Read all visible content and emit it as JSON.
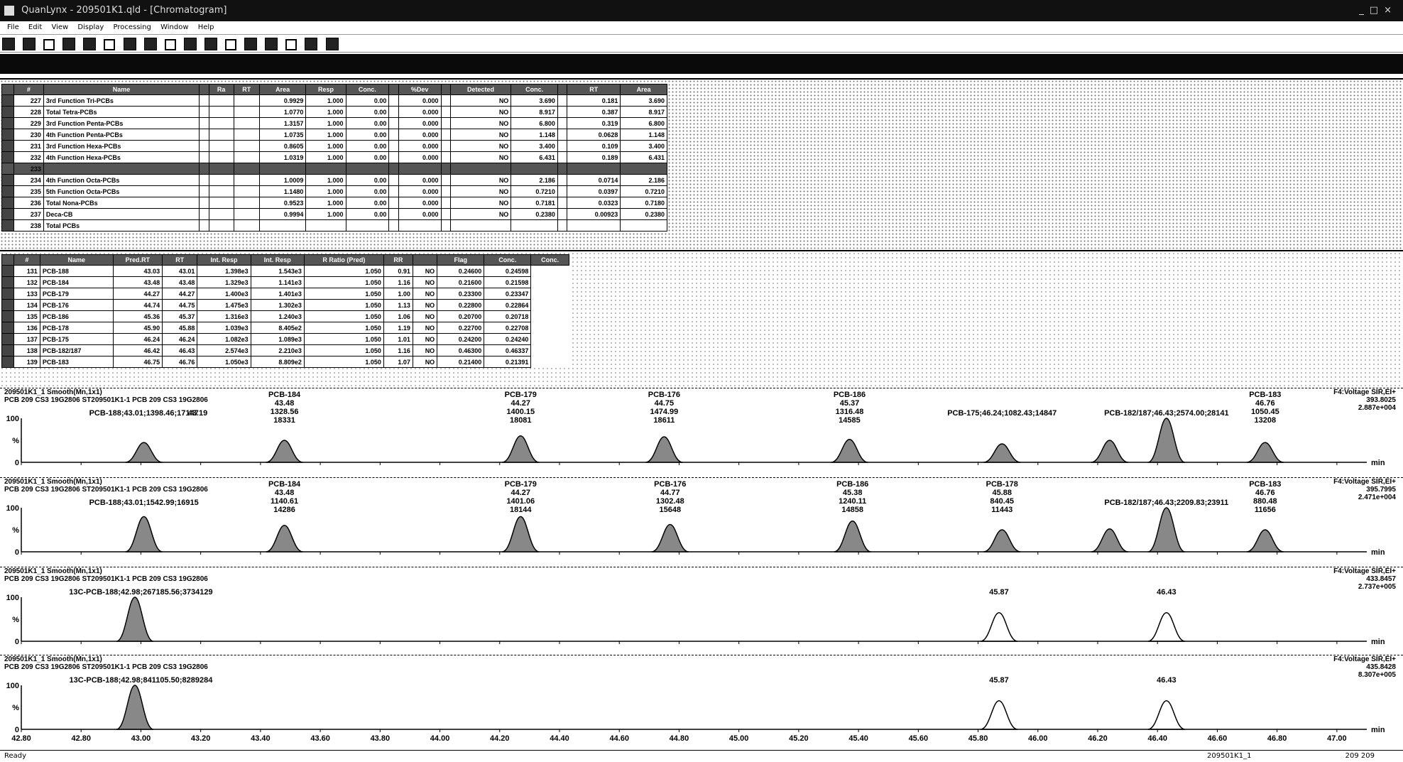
{
  "window": {
    "title": "QuanLynx - 209501K1.qld - [Chromatogram]"
  },
  "menu": [
    "File",
    "Edit",
    "View",
    "Display",
    "Processing",
    "Window",
    "Help"
  ],
  "table1": {
    "columns": [
      "#",
      "Name",
      "",
      "Ra",
      "RT",
      "Area",
      "Resp",
      "Conc.",
      "",
      "%Dev",
      "",
      "Detected",
      "Conc.",
      "",
      "RT",
      "Area"
    ],
    "rows": [
      [
        "227",
        "3rd Function Tri-PCBs",
        "",
        "",
        "",
        "0.9929",
        "1.000",
        "0.00",
        "",
        "0.000",
        "",
        "NO",
        "3.690",
        "",
        "0.181",
        "3.690"
      ],
      [
        "228",
        "Total Tetra-PCBs",
        "",
        "",
        "",
        "1.0770",
        "1.000",
        "0.00",
        "",
        "0.000",
        "",
        "NO",
        "8.917",
        "",
        "0.387",
        "8.917"
      ],
      [
        "229",
        "3rd Function Penta-PCBs",
        "",
        "",
        "",
        "1.3157",
        "1.000",
        "0.00",
        "",
        "0.000",
        "",
        "NO",
        "6.800",
        "",
        "0.319",
        "6.800"
      ],
      [
        "230",
        "4th Function Penta-PCBs",
        "",
        "",
        "",
        "1.0735",
        "1.000",
        "0.00",
        "",
        "0.000",
        "",
        "NO",
        "1.148",
        "",
        "0.0628",
        "1.148"
      ],
      [
        "231",
        "3rd Function Hexa-PCBs",
        "",
        "",
        "",
        "0.8605",
        "1.000",
        "0.00",
        "",
        "0.000",
        "",
        "NO",
        "3.400",
        "",
        "0.109",
        "3.400"
      ],
      [
        "232",
        "4th Function Hexa-PCBs",
        "",
        "",
        "",
        "1.0319",
        "1.000",
        "0.00",
        "",
        "0.000",
        "",
        "NO",
        "6.431",
        "",
        "0.189",
        "6.431"
      ],
      [
        "233",
        "",
        "",
        "",
        "",
        "",
        "",
        "",
        "",
        "",
        "",
        "",
        "",
        "",
        "",
        ""
      ],
      [
        "234",
        "4th Function Octa-PCBs",
        "",
        "",
        "",
        "1.0009",
        "1.000",
        "0.00",
        "",
        "0.000",
        "",
        "NO",
        "2.186",
        "",
        "0.0714",
        "2.186"
      ],
      [
        "235",
        "5th Function Octa-PCBs",
        "",
        "",
        "",
        "1.1480",
        "1.000",
        "0.00",
        "",
        "0.000",
        "",
        "NO",
        "0.7210",
        "",
        "0.0397",
        "0.7210"
      ],
      [
        "236",
        "Total Nona-PCBs",
        "",
        "",
        "",
        "0.9523",
        "1.000",
        "0.00",
        "",
        "0.000",
        "",
        "NO",
        "0.7181",
        "",
        "0.0323",
        "0.7180"
      ],
      [
        "237",
        "Deca-CB",
        "",
        "",
        "",
        "0.9994",
        "1.000",
        "0.00",
        "",
        "0.000",
        "",
        "NO",
        "0.2380",
        "",
        "0.00923",
        "0.2380"
      ],
      [
        "238",
        "Total PCBs",
        "",
        "",
        "",
        "",
        "",
        "",
        "",
        "",
        "",
        "",
        "",
        "",
        "",
        ""
      ]
    ]
  },
  "table2": {
    "columns": [
      "#",
      "Name",
      "Pred.RT",
      "RT",
      "Int. Resp",
      "Int. Resp",
      "R Ratio (Pred)",
      "RR",
      "",
      "Flag",
      "Conc.",
      "Conc."
    ],
    "rows": [
      [
        "131",
        "PCB-188",
        "43.03",
        "43.01",
        "1.398e3",
        "1.543e3",
        "1.050",
        "0.91",
        "NO",
        "0.24600",
        "0.24598"
      ],
      [
        "132",
        "PCB-184",
        "43.48",
        "43.48",
        "1.329e3",
        "1.141e3",
        "1.050",
        "1.16",
        "NO",
        "0.21600",
        "0.21598"
      ],
      [
        "133",
        "PCB-179",
        "44.27",
        "44.27",
        "1.400e3",
        "1.401e3",
        "1.050",
        "1.00",
        "NO",
        "0.23300",
        "0.23347"
      ],
      [
        "134",
        "PCB-176",
        "44.74",
        "44.75",
        "1.475e3",
        "1.302e3",
        "1.050",
        "1.13",
        "NO",
        "0.22800",
        "0.22864"
      ],
      [
        "135",
        "PCB-186",
        "45.36",
        "45.37",
        "1.316e3",
        "1.240e3",
        "1.050",
        "1.06",
        "NO",
        "0.20700",
        "0.20718"
      ],
      [
        "136",
        "PCB-178",
        "45.90",
        "45.88",
        "1.039e3",
        "8.405e2",
        "1.050",
        "1.19",
        "NO",
        "0.22700",
        "0.22708"
      ],
      [
        "137",
        "PCB-175",
        "46.24",
        "46.24",
        "1.082e3",
        "1.089e3",
        "1.050",
        "1.01",
        "NO",
        "0.24200",
        "0.24240"
      ],
      [
        "138",
        "PCB-182/187",
        "46.42",
        "46.43",
        "2.574e3",
        "2.210e3",
        "1.050",
        "1.16",
        "NO",
        "0.46300",
        "0.46337"
      ],
      [
        "139",
        "PCB-183",
        "46.75",
        "46.76",
        "1.050e3",
        "8.809e2",
        "1.050",
        "1.07",
        "NO",
        "0.21400",
        "0.21391"
      ]
    ]
  },
  "traces": [
    {
      "header": [
        "209501K1_1 Smooth(Mn,1x1)",
        "PCB 209 CS3 19G2806 ST209501K1-1 PCB 209 CS3 19G2806"
      ],
      "right": [
        "F4:Voltage SIR,EI+",
        "393.8025",
        "2.887e+004"
      ],
      "labels": [
        {
          "t": 43.01,
          "text": "PCB-188;43.01;1398.46;17147",
          "dy": 0
        },
        {
          "t": 43.19,
          "text": "43.19",
          "dy": 0
        },
        {
          "t": 43.48,
          "text": "PCB-184\n43.48\n1328.56\n18331",
          "dy": 0
        },
        {
          "t": 44.27,
          "text": "PCB-179\n44.27\n1400.15\n18081",
          "dy": 0
        },
        {
          "t": 44.75,
          "text": "PCB-176\n44.75\n1474.99\n18611",
          "dy": 0
        },
        {
          "t": 45.37,
          "text": "PCB-186\n45.37\n1316.48\n14585",
          "dy": 0
        },
        {
          "t": 45.88,
          "text": "PCB-175;46.24;1082.43;14847",
          "dy": 0
        },
        {
          "t": 46.43,
          "text": "PCB-182/187;46.43;2574.00;28141",
          "dy": 0
        },
        {
          "t": 46.76,
          "text": "PCB-183\n46.76\n1050.45\n13208",
          "dy": 0
        }
      ],
      "peaks": [
        [
          43.01,
          0.45
        ],
        [
          43.48,
          0.5
        ],
        [
          44.27,
          0.6
        ],
        [
          44.75,
          0.58
        ],
        [
          45.37,
          0.52
        ],
        [
          45.88,
          0.42
        ],
        [
          46.24,
          0.5
        ],
        [
          46.43,
          1.0
        ],
        [
          46.76,
          0.45
        ]
      ],
      "filled": true
    },
    {
      "header": [
        "209501K1_1 Smooth(Mn,1x1)",
        "PCB 209 CS3 19G2806 ST209501K1-1 PCB 209 CS3 19G2806"
      ],
      "right": [
        "F4:Voltage SIR,EI+",
        "395.7995",
        "2.471e+004"
      ],
      "labels": [
        {
          "t": 43.01,
          "text": "PCB-188;43.01;1542.99;16915",
          "dy": 0
        },
        {
          "t": 43.48,
          "text": "PCB-184\n43.48\n1140.61\n14286",
          "dy": 0
        },
        {
          "t": 44.27,
          "text": "PCB-179\n44.27\n1401.06\n18144",
          "dy": 0
        },
        {
          "t": 44.77,
          "text": "PCB-176\n44.77\n1302.48\n15648",
          "dy": 0
        },
        {
          "t": 45.38,
          "text": "PCB-186\n45.38\n1240.11\n14858",
          "dy": 0
        },
        {
          "t": 45.88,
          "text": "PCB-178\n45.88\n840.45\n11443",
          "dy": 0
        },
        {
          "t": 46.43,
          "text": "PCB-182/187;46.43;2209.83;23911",
          "dy": 0
        },
        {
          "t": 46.76,
          "text": "PCB-183\n46.76\n880.48\n11656",
          "dy": 0
        }
      ],
      "peaks": [
        [
          43.01,
          0.8
        ],
        [
          43.48,
          0.6
        ],
        [
          44.27,
          0.8
        ],
        [
          44.77,
          0.62
        ],
        [
          45.38,
          0.7
        ],
        [
          45.88,
          0.5
        ],
        [
          46.24,
          0.52
        ],
        [
          46.43,
          1.0
        ],
        [
          46.76,
          0.5
        ]
      ],
      "filled": true
    },
    {
      "header": [
        "209501K1_1 Smooth(Mn,1x1)",
        "PCB 209 CS3 19G2806 ST209501K1-1 PCB 209 CS3 19G2806"
      ],
      "right": [
        "F4:Voltage SIR,EI+",
        "433.8457",
        "2.737e+005"
      ],
      "labels": [
        {
          "t": 43.0,
          "text": "13C-PCB-188;42.98;267185.56;3734129",
          "dy": 0
        },
        {
          "t": 45.87,
          "text": "45.87",
          "dy": 0
        },
        {
          "t": 46.43,
          "text": "46.43",
          "dy": 0
        }
      ],
      "peaks": [
        [
          42.98,
          1.0
        ]
      ],
      "outline": [
        [
          45.87,
          0.65
        ],
        [
          46.43,
          0.65
        ]
      ],
      "filled": true
    },
    {
      "header": [
        "209501K1_1 Smooth(Mn,1x1)",
        "PCB 209 CS3 19G2806 ST209501K1-1 PCB 209 CS3 19G2806"
      ],
      "right": [
        "F4:Voltage SIR,EI+",
        "435.8428",
        "8.307e+005"
      ],
      "labels": [
        {
          "t": 43.0,
          "text": "13C-PCB-188;42.98;841105.50;8289284",
          "dy": 0
        },
        {
          "t": 45.87,
          "text": "45.87",
          "dy": 0
        },
        {
          "t": 46.43,
          "text": "46.43",
          "dy": 0
        }
      ],
      "peaks": [
        [
          42.98,
          1.0
        ]
      ],
      "outline": [
        [
          45.87,
          0.65
        ],
        [
          46.43,
          0.65
        ]
      ],
      "filled": true
    }
  ],
  "axis": {
    "min": 42.6,
    "max": 47.1,
    "ticks": [
      "42.80",
      "42.80",
      "43.00",
      "43.20",
      "43.40",
      "43.60",
      "43.80",
      "44.00",
      "44.20",
      "44.40",
      "44.60",
      "44.80",
      "45.00",
      "45.20",
      "45.40",
      "45.60",
      "45.80",
      "46.00",
      "46.20",
      "46.40",
      "46.60",
      "46.80",
      "47.00"
    ],
    "tickvals": [
      42.6,
      42.8,
      43.0,
      43.2,
      43.4,
      43.6,
      43.8,
      44.0,
      44.2,
      44.4,
      44.6,
      44.8,
      45.0,
      45.2,
      45.4,
      45.6,
      45.8,
      46.0,
      46.2,
      46.4,
      46.6,
      46.8,
      47.0
    ],
    "unit": "min",
    "yticks": [
      "100",
      "%",
      "0"
    ]
  },
  "status": {
    "left": "Ready",
    "center": "209501K1_1",
    "right": "209 209"
  }
}
